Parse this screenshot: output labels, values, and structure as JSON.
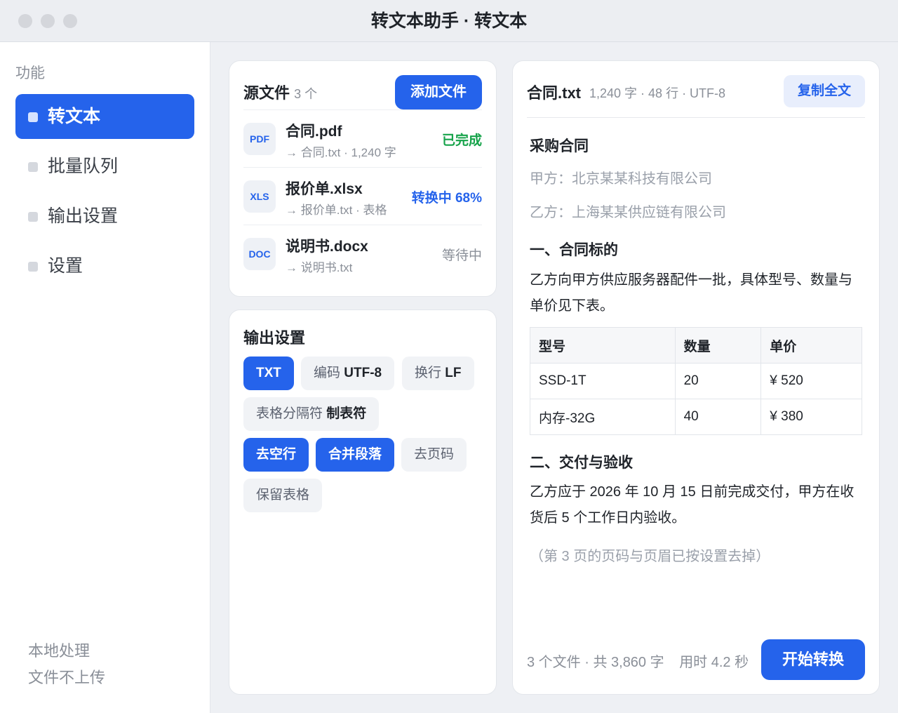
{
  "window": {
    "title": "转文本助手 · 转文本"
  },
  "sidebar": {
    "heading": "功能",
    "items": [
      {
        "label": "转文本",
        "active": true
      },
      {
        "label": "批量队列",
        "active": false
      },
      {
        "label": "输出设置",
        "active": false
      },
      {
        "label": "设置",
        "active": false
      }
    ],
    "footer_line1": "本地处理",
    "footer_line2": "文件不上传"
  },
  "sources": {
    "title": "源文件",
    "count": "3 个",
    "add_button": "添加文件",
    "files": [
      {
        "icon": "PDF",
        "name": "合同.pdf",
        "sub": "→ 合同.txt · 1,240 字",
        "status": "已完成",
        "status_color": "#16a34a"
      },
      {
        "icon": "XLS",
        "name": "报价单.xlsx",
        "sub": "→ 报价单.txt · 表格",
        "status": "转换中 68%",
        "status_color": "#2563eb"
      },
      {
        "icon": "DOC",
        "name": "说明书.docx",
        "sub": "→ 说明书.txt",
        "status": "等待中",
        "status_color": "#8a8f98"
      }
    ]
  },
  "output_settings": {
    "title": "输出设置",
    "format": "TXT",
    "encoding_label": "编码",
    "encoding_value": "UTF-8",
    "newline_label": "换行",
    "newline_value": "LF",
    "separator_label": "表格分隔符",
    "separator_value": "制表符",
    "options": [
      {
        "label": "去空行",
        "on": true
      },
      {
        "label": "合并段落",
        "on": true
      },
      {
        "label": "去页码",
        "on": false
      },
      {
        "label": "保留表格",
        "on": false
      }
    ]
  },
  "preview": {
    "file_name": "合同.txt",
    "meta": "1,240 字 · 48 行 · UTF-8",
    "copy_button": "复制全文",
    "doc_title": "采购合同",
    "party_a": "甲方：北京某某科技有限公司",
    "party_b": "乙方：上海某某供应链有限公司",
    "section1_title": "一、合同标的",
    "section1_line1": "乙方向甲方供应服务器配件一批，具体型号、数量与",
    "section1_line2": "单价见下表。",
    "table": {
      "headers": [
        "型号",
        "数量",
        "单价"
      ],
      "rows": [
        [
          "SSD-1T",
          "20",
          "¥ 520"
        ],
        [
          "内存-32G",
          "40",
          "¥ 380"
        ]
      ]
    },
    "section2_title": "二、交付与验收",
    "section2_line1": "乙方应于 2026 年 10 月 15 日前完成交付，甲方在收",
    "section2_line2": "货后 5 个工作日内验收。",
    "note": "（第 3 页的页码与页眉已按设置去掉）",
    "summary": "3 个文件 · 共 3,860 字",
    "elapsed": "用时 4.2 秒",
    "start_button": "开始转换"
  }
}
